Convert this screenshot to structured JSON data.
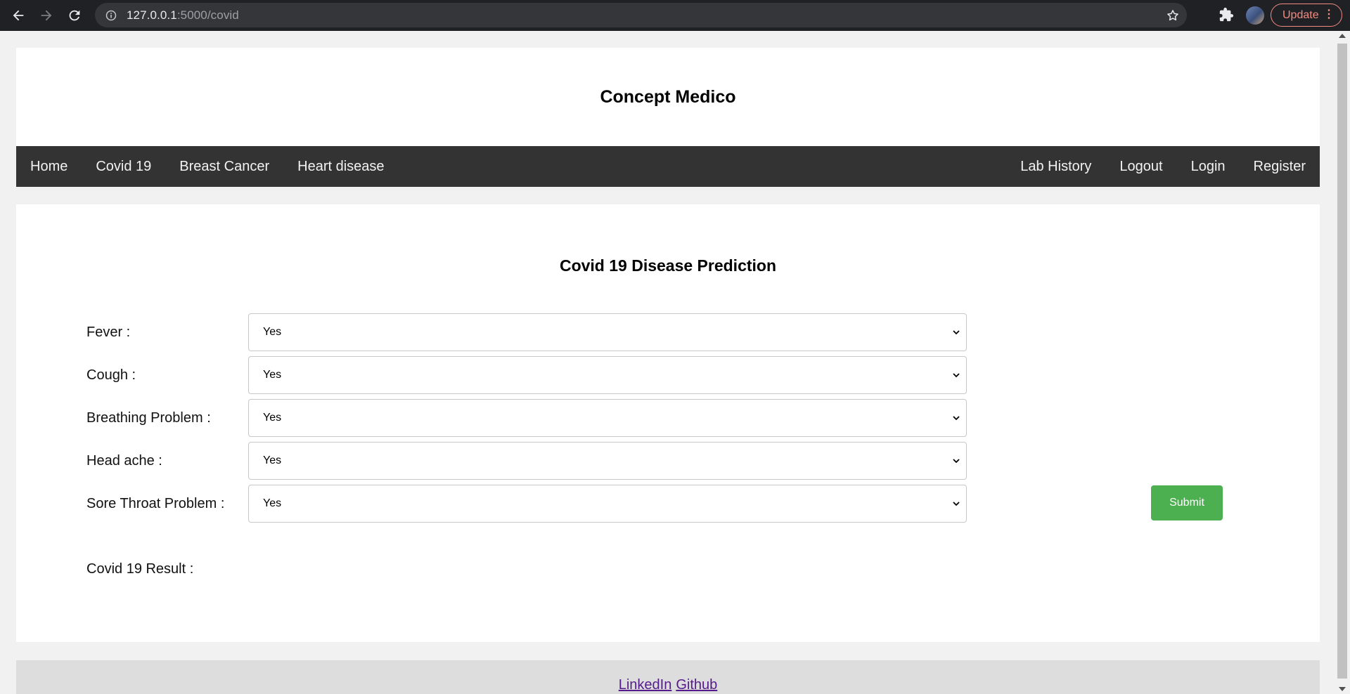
{
  "browser": {
    "url_host": "127.0.0.1",
    "url_path": ":5000/covid",
    "update_label": "Update"
  },
  "site": {
    "title": "Concept Medico"
  },
  "nav": {
    "left": [
      {
        "label": "Home"
      },
      {
        "label": "Covid 19"
      },
      {
        "label": "Breast Cancer"
      },
      {
        "label": "Heart disease"
      }
    ],
    "right": [
      {
        "label": "Lab History"
      },
      {
        "label": "Logout"
      },
      {
        "label": "Login"
      },
      {
        "label": "Register"
      }
    ]
  },
  "form": {
    "title": "Covid 19 Disease Prediction",
    "fields": [
      {
        "label": "Fever :",
        "value": "Yes"
      },
      {
        "label": "Cough :",
        "value": "Yes"
      },
      {
        "label": "Breathing Problem :",
        "value": "Yes"
      },
      {
        "label": "Head ache :",
        "value": "Yes"
      },
      {
        "label": "Sore Throat Problem :",
        "value": "Yes"
      }
    ],
    "submit_label": "Submit",
    "result_label": "Covid 19 Result :"
  },
  "footer": {
    "links": [
      {
        "label": "LinkedIn"
      },
      {
        "label": "Github"
      }
    ]
  },
  "colors": {
    "nav_bg": "#333333",
    "submit_bg": "#4caf50",
    "link": "#551a8b"
  }
}
